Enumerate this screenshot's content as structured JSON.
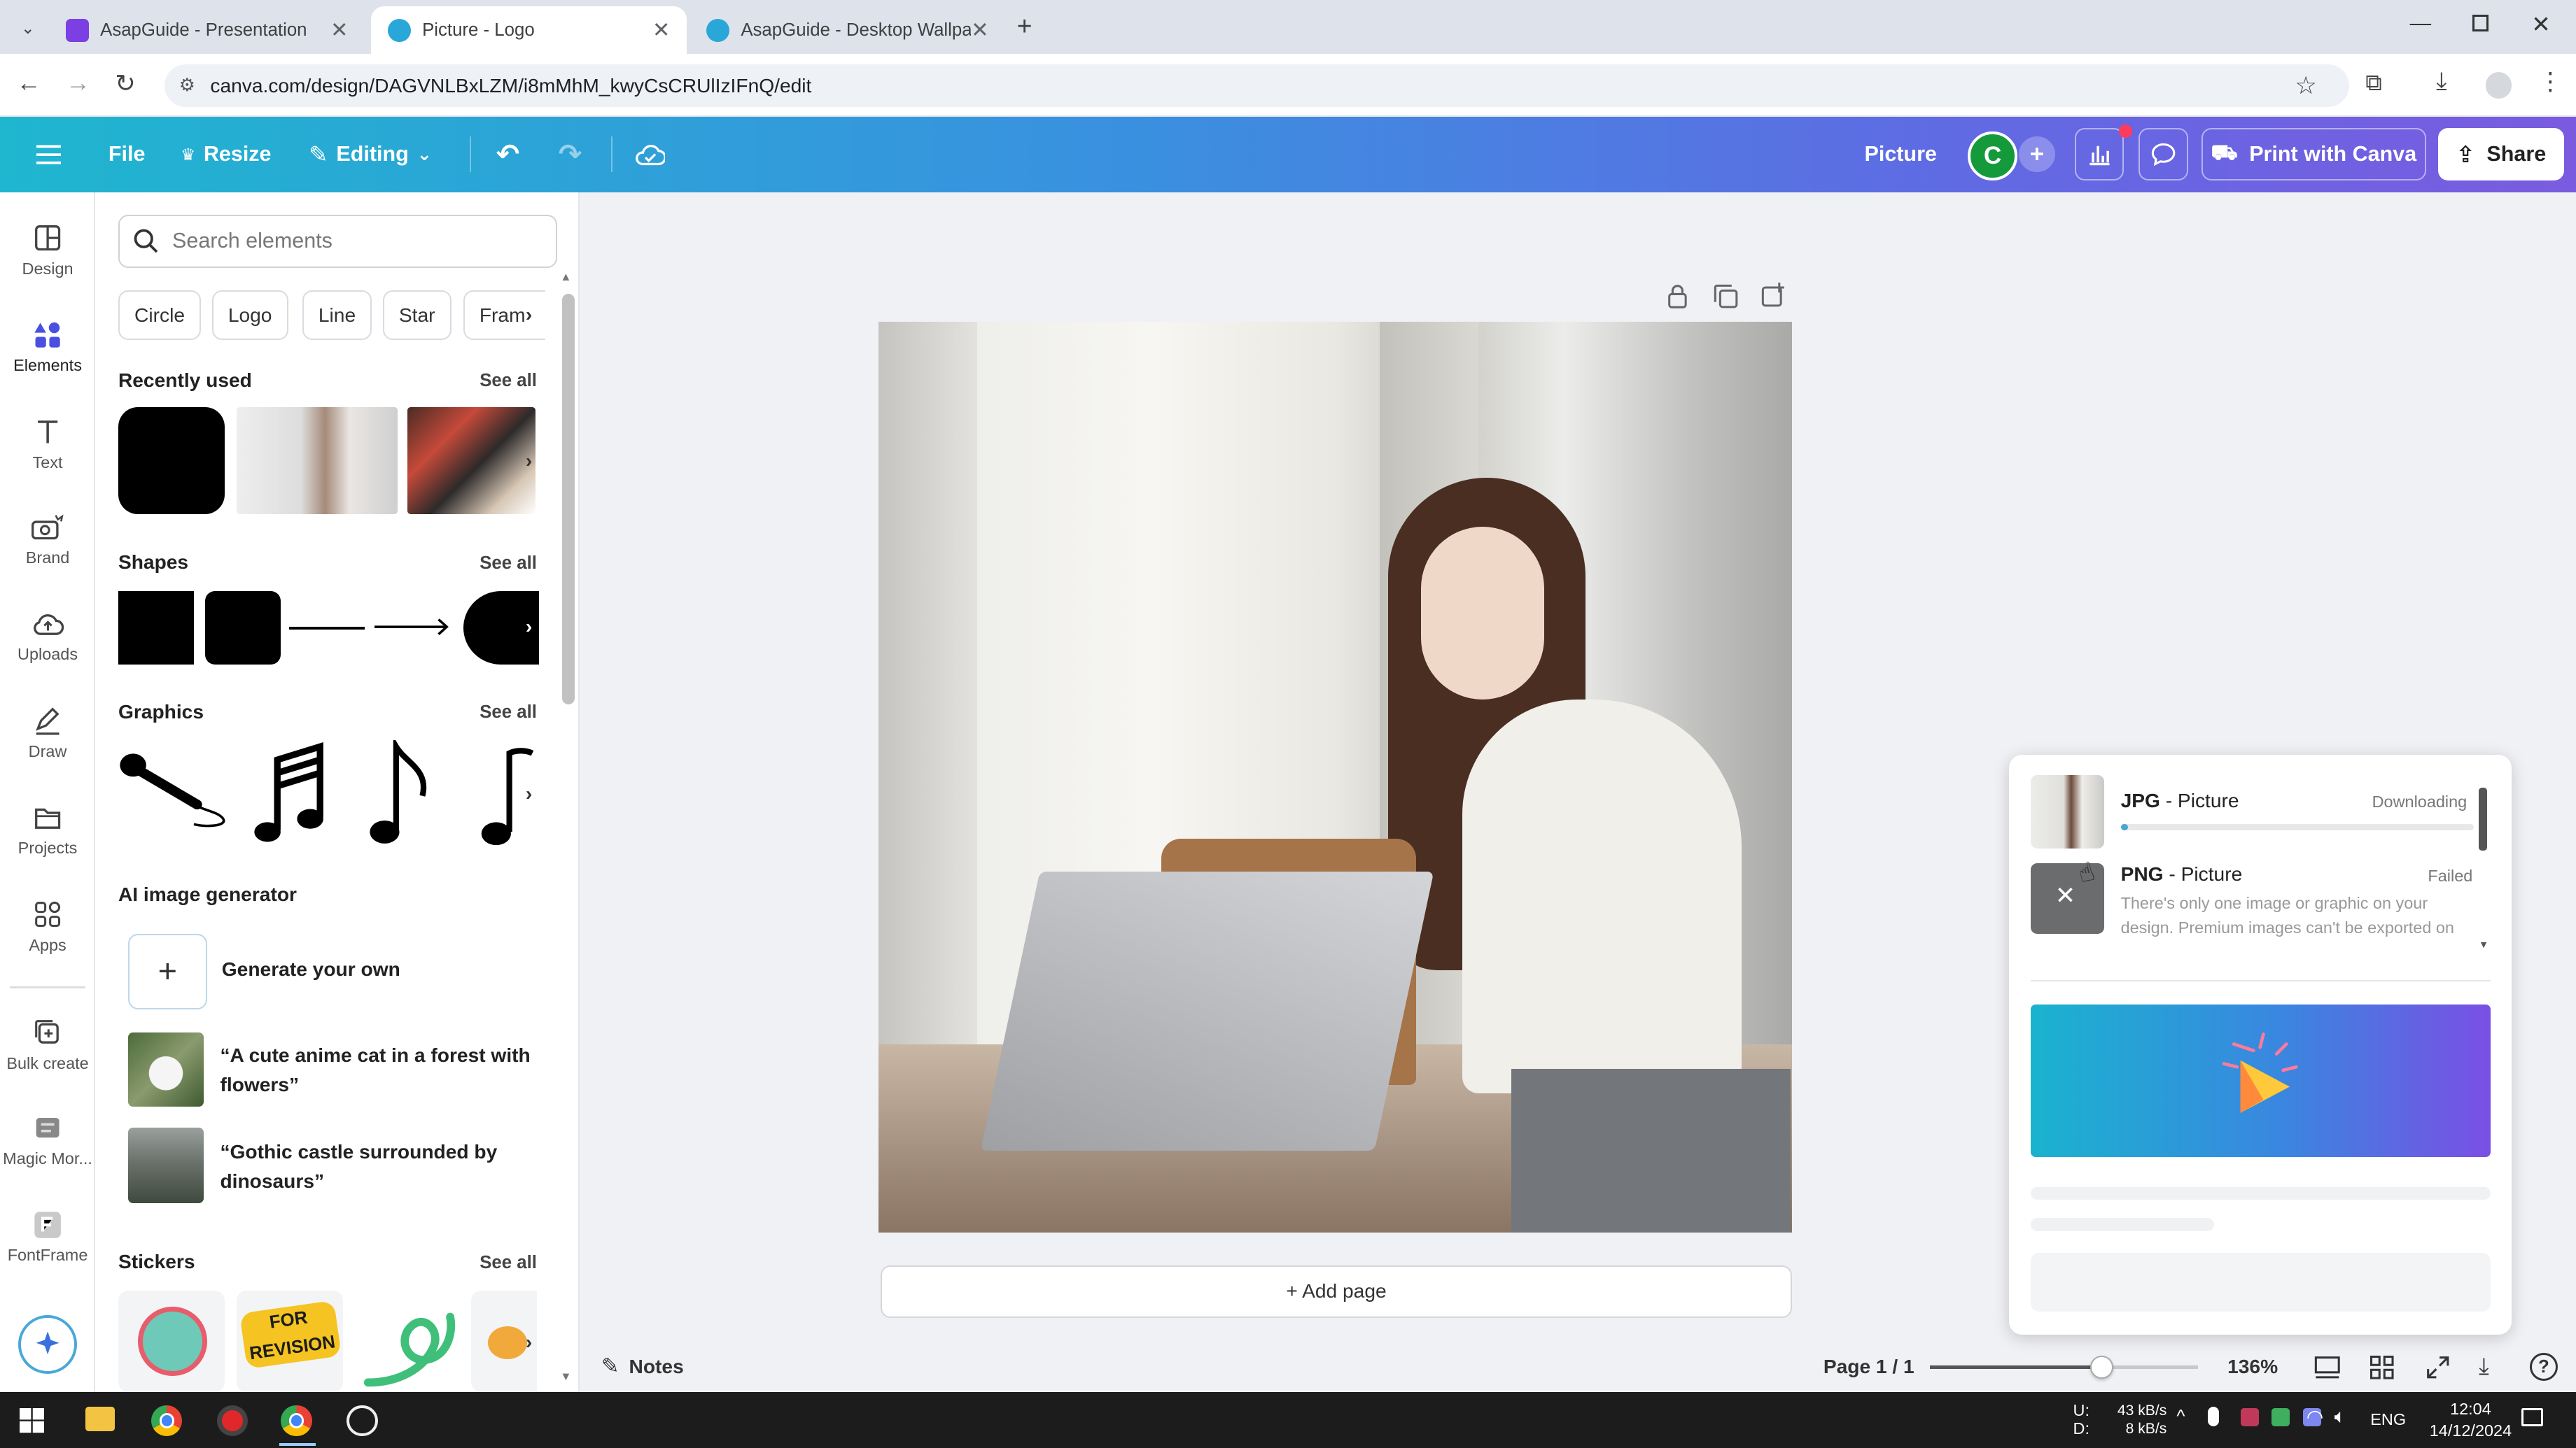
{
  "browser": {
    "tabs": [
      {
        "title": "AsapGuide - Presentation",
        "active": false
      },
      {
        "title": "Picture - Logo",
        "active": true
      },
      {
        "title": "AsapGuide - Desktop Wallpape",
        "active": false
      }
    ],
    "url": "canva.com/design/DAGVNLBxLZM/i8mMhM_kwyCsCRUlIzIFnQ/edit"
  },
  "toolbar": {
    "file": "File",
    "resize": "Resize",
    "editing": "Editing",
    "doc_title": "Picture",
    "avatar_letter": "C",
    "print": "Print with Canva",
    "share": "Share"
  },
  "rail": [
    {
      "label": "Design",
      "icon": "design-icon"
    },
    {
      "label": "Elements",
      "icon": "elements-icon",
      "active": true
    },
    {
      "label": "Text",
      "icon": "text-icon"
    },
    {
      "label": "Brand",
      "icon": "brand-icon"
    },
    {
      "label": "Uploads",
      "icon": "uploads-icon"
    },
    {
      "label": "Draw",
      "icon": "draw-icon"
    },
    {
      "label": "Projects",
      "icon": "projects-icon"
    },
    {
      "label": "Apps",
      "icon": "apps-icon"
    },
    {
      "label": "Bulk create",
      "icon": "bulk-create-icon"
    },
    {
      "label": "Magic Mor...",
      "icon": "magic-morph-icon"
    },
    {
      "label": "FontFrame",
      "icon": "fontframe-icon"
    }
  ],
  "panel": {
    "search_placeholder": "Search elements",
    "chips": [
      "Circle",
      "Logo",
      "Line",
      "Star",
      "Fram"
    ],
    "recently_used": "Recently used",
    "shapes": "Shapes",
    "graphics": "Graphics",
    "ai": "AI image generator",
    "generate": "Generate your own",
    "prompt1": "“A cute anime cat in a forest with flowers”",
    "prompt2": "“Gothic castle surrounded by dinosaurs”",
    "stickers": "Stickers",
    "see_all": "See all",
    "sticker_text": "FOR REVISION"
  },
  "canvas": {
    "add_page": "+ Add page"
  },
  "bottom": {
    "notes": "Notes",
    "page": "Page 1 / 1",
    "zoom": "136%",
    "zoom_level": 0.64
  },
  "downloads": [
    {
      "format": "JPG",
      "name": " - Picture",
      "status": "Downloading",
      "progress": 0.02
    },
    {
      "format": "PNG",
      "name": " - Picture",
      "status": "Failed",
      "message": "There's only one image or graphic on your design. Premium images can't be exported on"
    }
  ],
  "taskbar": {
    "net_up": "U:",
    "net_down": "D:",
    "up_rate": "43 kB/s",
    "down_rate": "8 kB/s",
    "lang": "ENG",
    "time": "12:04",
    "date": "14/12/2024"
  }
}
